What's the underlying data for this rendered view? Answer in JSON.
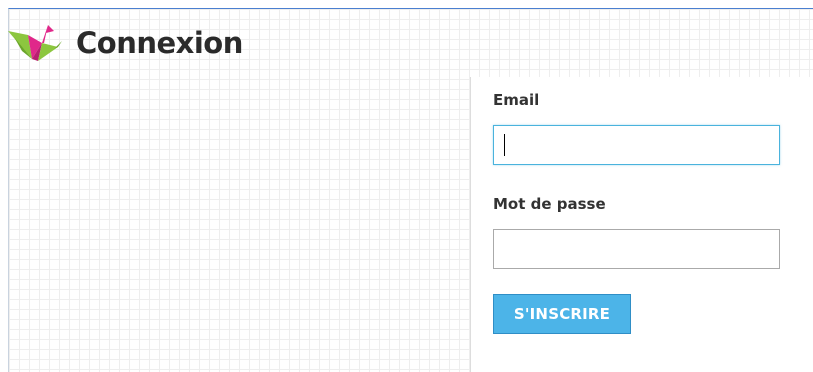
{
  "header": {
    "title": "Connexion",
    "logo_icon": "crane-logo-icon"
  },
  "form": {
    "email": {
      "label": "Email",
      "value": "",
      "placeholder": ""
    },
    "password": {
      "label": "Mot de passe",
      "value": "",
      "placeholder": ""
    },
    "submit_label": "S'INSCRIRE"
  },
  "colors": {
    "accent": "#4cb4e8",
    "focus_border": "#4ab3dd",
    "title_text": "#2b2b2b",
    "logo_pink": "#e0288a",
    "logo_green": "#8cc63f"
  }
}
